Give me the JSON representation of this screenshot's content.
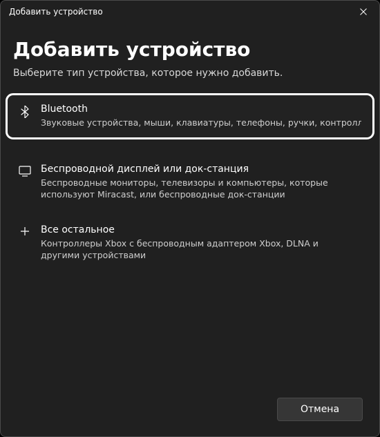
{
  "titlebar": {
    "title": "Добавить устройство"
  },
  "heading": "Добавить устройство",
  "subheading": "Выберите тип устройства, которое нужно добавить.",
  "options": {
    "bluetooth": {
      "title": "Bluetooth",
      "desc": "Звуковые устройства, мыши, клавиатуры, телефоны, ручки, контроллеры и прочее"
    },
    "wireless_display": {
      "title": "Беспроводной дисплей или док-станция",
      "desc": "Беспроводные мониторы, телевизоры и компьютеры, которые используют Miracast, или беспроводные док-станции"
    },
    "other": {
      "title": "Все остальное",
      "desc": "Контроллеры Xbox с беспроводным адаптером Xbox, DLNA и другими устройствами"
    }
  },
  "footer": {
    "cancel": "Отмена"
  }
}
